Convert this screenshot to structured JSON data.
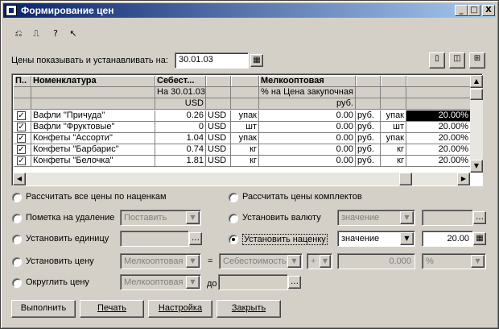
{
  "window": {
    "title": "Формирование цен",
    "minimize": "_",
    "maximize": "□",
    "close": "X"
  },
  "filter": {
    "label": "Цены показывать и устанавливать на:",
    "date": "30.01.03"
  },
  "grid": {
    "headers": [
      "П..",
      "Номенклатура",
      "Себест...",
      "",
      "",
      "Мелкооптовая",
      "",
      "",
      ""
    ],
    "subheaders": [
      "",
      "",
      "На 30.01.03",
      "",
      "",
      "% на Цена закупочная",
      "",
      "",
      ""
    ],
    "subheaders2": [
      "",
      "",
      "USD",
      "",
      "",
      "руб.",
      "",
      "",
      ""
    ],
    "rows": [
      {
        "checked": true,
        "name": "Вафли \"Причуда\"",
        "cost": "0.26",
        "cur": "USD",
        "unit": "упак",
        "val": "0.00",
        "rub": "руб.",
        "unit2": "упак",
        "pct": "20.00%",
        "selected": true
      },
      {
        "checked": true,
        "name": "Вафли \"Фруктовые\"",
        "cost": "0",
        "cur": "USD",
        "unit": "шт",
        "val": "0.00",
        "rub": "руб.",
        "unit2": "шт",
        "pct": "20.00%",
        "selected": false
      },
      {
        "checked": true,
        "name": "Конфеты \"Ассорти\"",
        "cost": "1.04",
        "cur": "USD",
        "unit": "упак",
        "val": "0.00",
        "rub": "руб.",
        "unit2": "упак",
        "pct": "20.00%",
        "selected": false
      },
      {
        "checked": true,
        "name": "Конфеты \"Барбарис\"",
        "cost": "0.74",
        "cur": "USD",
        "unit": "кг",
        "val": "0.00",
        "rub": "руб.",
        "unit2": "кг",
        "pct": "20.00%",
        "selected": false
      },
      {
        "checked": true,
        "name": "Конфеты \"Белочка\"",
        "cost": "1.81",
        "cur": "USD",
        "unit": "кг",
        "val": "0.00",
        "rub": "руб.",
        "unit2": "кг",
        "pct": "20.00%",
        "selected": false
      }
    ]
  },
  "options": {
    "recalc_all": "Рассчитать все цены по наценкам",
    "recalc_sets": "Рассчитать цены комплектов",
    "mark_delete": "Пометка на удаление",
    "mark_delete_value": "Поставить",
    "set_currency": "Установить валюту",
    "set_currency_value": "значение",
    "set_unit": "Установить единицу",
    "set_markup": "Установить наценку",
    "set_markup_value": "значение",
    "set_markup_amount": "20.00",
    "set_price": "Установить цену",
    "set_price_type": "Мелкооптовая",
    "equals": "=",
    "set_price_base": "Себестоимость",
    "set_price_op": "+",
    "set_price_amount": "0.000",
    "set_price_unit": "%",
    "round_price": "Округлить цену",
    "round_price_type": "Мелкооптовая",
    "to_label": "до"
  },
  "buttons": {
    "execute": "Выполнить",
    "print": "Печать",
    "settings": "Настройка",
    "close": "Закрыть"
  },
  "colors": {
    "title_start": "#0a246a",
    "title_end": "#a6caf0",
    "face": "#d4d0c8"
  }
}
